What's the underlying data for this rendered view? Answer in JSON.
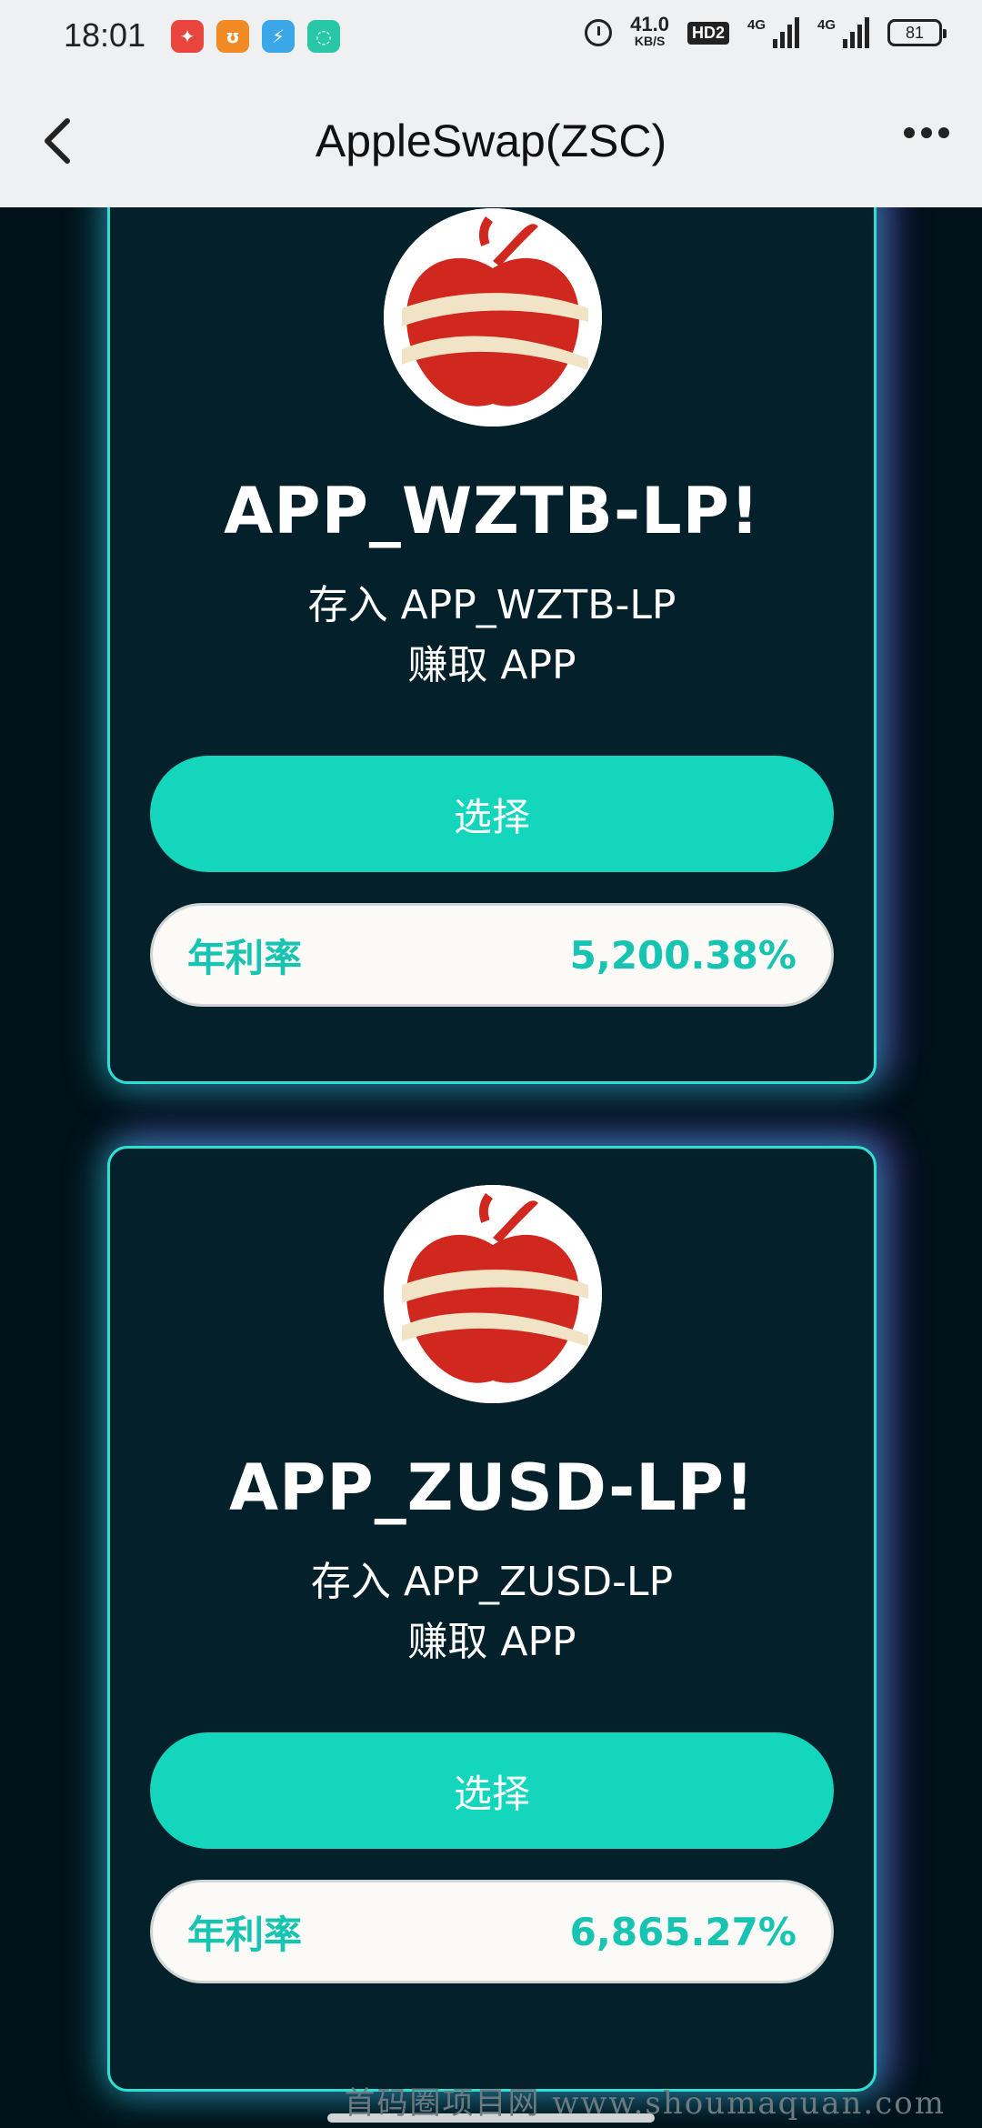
{
  "status_bar": {
    "time": "18:01",
    "net_speed_value": "41.0",
    "net_speed_unit": "KB/S",
    "hd": "HD2",
    "net1": "4G",
    "net2": "4G",
    "battery": "81"
  },
  "nav": {
    "title": "AppleSwap(ZSC)"
  },
  "pools": [
    {
      "title": "APP_WZTB-LP!",
      "deposit": "存入 APP_WZTB-LP",
      "earn": "赚取 APP",
      "select_label": "选择",
      "apr_label": "年利率",
      "apr_value": "5,200.38%"
    },
    {
      "title": "APP_ZUSD-LP!",
      "deposit": "存入 APP_ZUSD-LP",
      "earn": "赚取 APP",
      "select_label": "选择",
      "apr_label": "年利率",
      "apr_value": "6,865.27%"
    }
  ],
  "watermark": "首码圈项目网 www.shoumaquan.com",
  "colors": {
    "accent": "#13d6bc",
    "card_bg": "#03202b",
    "page_bg": "#02121a"
  }
}
